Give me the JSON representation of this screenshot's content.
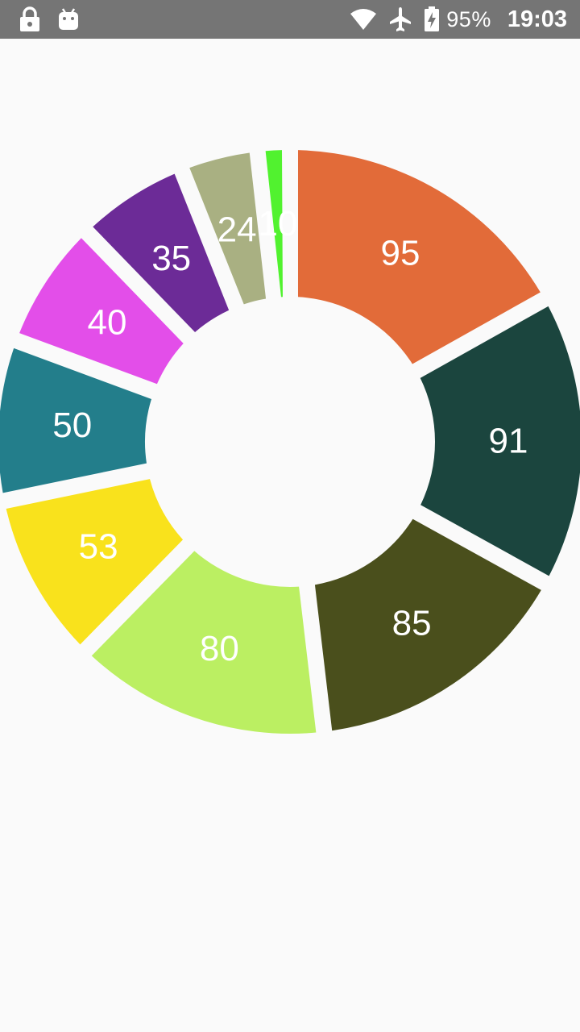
{
  "status_bar": {
    "left_icons": [
      "lock-icon",
      "android-icon"
    ],
    "right_icons": [
      "wifi-icon",
      "airplane-mode-icon",
      "battery-charging-icon"
    ],
    "battery_percent": "95%",
    "time": "19:03"
  },
  "chart_data": {
    "type": "pie",
    "style": "donut",
    "values": [
      95,
      91,
      85,
      80,
      53,
      50,
      40,
      35,
      24,
      10
    ],
    "labels": [
      "95",
      "91",
      "85",
      "80",
      "53",
      "50",
      "40",
      "35",
      "24",
      "10"
    ],
    "colors": [
      "#e26b39",
      "#1b453e",
      "#4a4f1c",
      "#bbef62",
      "#f9e21c",
      "#237e8b",
      "#e34ee9",
      "#6c2b97",
      "#a9b082",
      "#51f22f"
    ],
    "legend": "none",
    "title": ""
  }
}
